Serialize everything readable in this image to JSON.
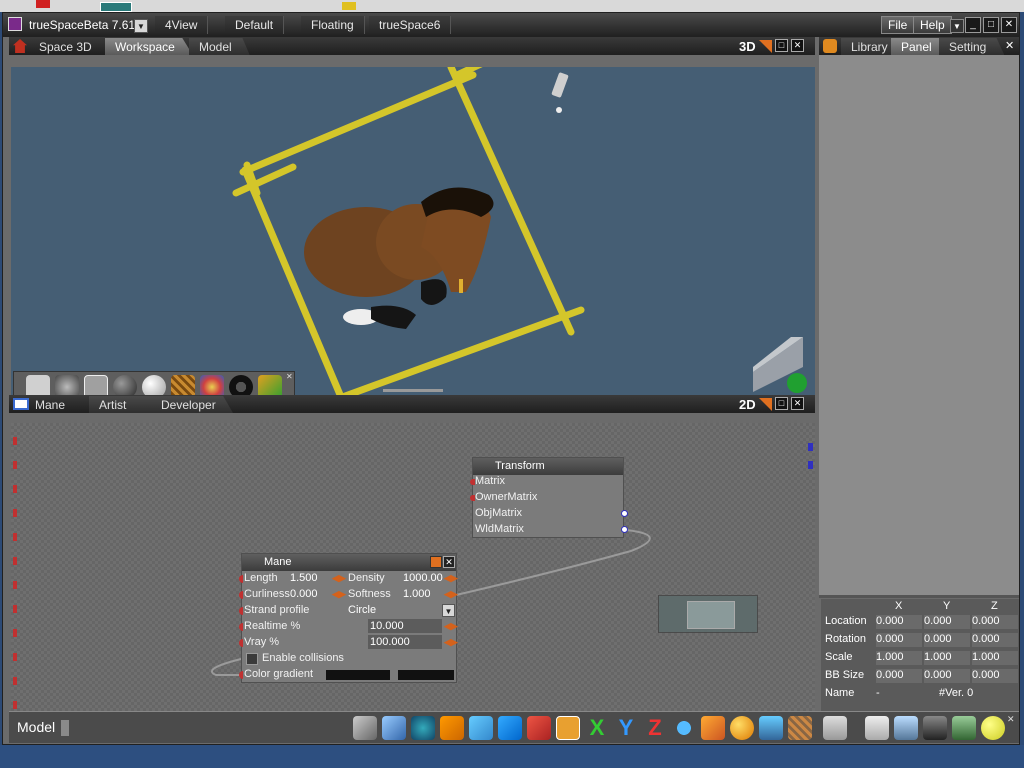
{
  "app": {
    "title": "trueSpaceBeta 7.61"
  },
  "title_tabs": [
    "4View",
    "Default",
    "Floating",
    "trueSpace6"
  ],
  "menu": {
    "file": "File",
    "help": "Help"
  },
  "workspace": {
    "space_label": "Space 3D",
    "tabs": [
      "Workspace",
      "Model"
    ],
    "view_mode": "3D"
  },
  "right_panel": {
    "tabs": [
      "Library",
      "Panel",
      "Setting"
    ]
  },
  "editor2d": {
    "space_label": "Mane",
    "tabs": [
      "Artist",
      "Developer"
    ],
    "view_mode": "2D"
  },
  "transform_node": {
    "title": "Transform",
    "pins": [
      "Matrix",
      "OwnerMatrix",
      "ObjMatrix",
      "WldMatrix"
    ]
  },
  "mane_node": {
    "title": "Mane",
    "length": {
      "label": "Length",
      "value": "1.500"
    },
    "density": {
      "label": "Density",
      "value": "1000.00"
    },
    "curliness": {
      "label": "Curliness",
      "value": "0.000"
    },
    "softness": {
      "label": "Softness",
      "value": "1.000"
    },
    "strand_profile": {
      "label": "Strand profile",
      "value": "Circle"
    },
    "realtime": {
      "label": "Realtime %",
      "value": "10.000"
    },
    "vray": {
      "label": "Vray %",
      "value": "100.000"
    },
    "collisions": {
      "label": "Enable collisions",
      "checked": false
    },
    "gradient": {
      "label": "Color gradient"
    }
  },
  "properties": {
    "columns": [
      "X",
      "Y",
      "Z"
    ],
    "rows": [
      {
        "label": "Location",
        "x": "0.000",
        "y": "0.000",
        "z": "0.000"
      },
      {
        "label": "Rotation",
        "x": "0.000",
        "y": "0.000",
        "z": "0.000"
      },
      {
        "label": "Scale",
        "x": "1.000",
        "y": "1.000",
        "z": "1.000"
      },
      {
        "label": "BB Size",
        "x": "0.000",
        "y": "0.000",
        "z": "0.000"
      }
    ],
    "name_label": "Name",
    "name_value": "-",
    "vertex_label": "#Ver. 0"
  },
  "status": {
    "mode": "Model"
  },
  "colors": {
    "viewport": "#455e74",
    "frame": "#d4c62a",
    "horse": "#7a4a22",
    "accent": "#e07020"
  }
}
